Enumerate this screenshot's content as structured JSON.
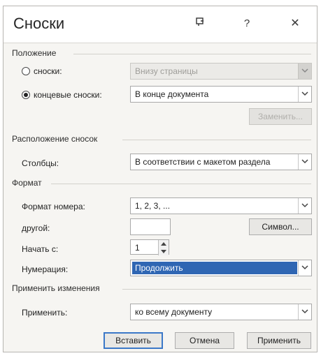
{
  "window": {
    "title": "Сноски",
    "help_label": "?",
    "close_label": "✕",
    "pin_icon": "pin-icon"
  },
  "position": {
    "section_title": "Положение",
    "footnotes_label": "сноски:",
    "footnotes_value": "Внизу страницы",
    "endnotes_label": "концевые сноски:",
    "endnotes_value": "В конце документа",
    "selected": "endnotes",
    "replace_button": "Заменить..."
  },
  "layout": {
    "section_title": "Расположение сносок",
    "columns_label": "Столбцы:",
    "columns_value": "В соответствии с макетом раздела"
  },
  "format": {
    "section_title": "Формат",
    "number_format_label": "Формат номера:",
    "number_format_value": "1, 2, 3, ...",
    "custom_label": "другой:",
    "custom_value": "",
    "symbol_button": "Символ...",
    "start_at_label": "Начать с:",
    "start_at_value": "1",
    "numbering_label": "Нумерация:",
    "numbering_value": "Продолжить"
  },
  "apply": {
    "section_title": "Применить изменения",
    "apply_to_label": "Применить:",
    "apply_to_value": "ко всему документу"
  },
  "buttons": {
    "insert": "Вставить",
    "cancel": "Отмена",
    "apply": "Применить"
  }
}
